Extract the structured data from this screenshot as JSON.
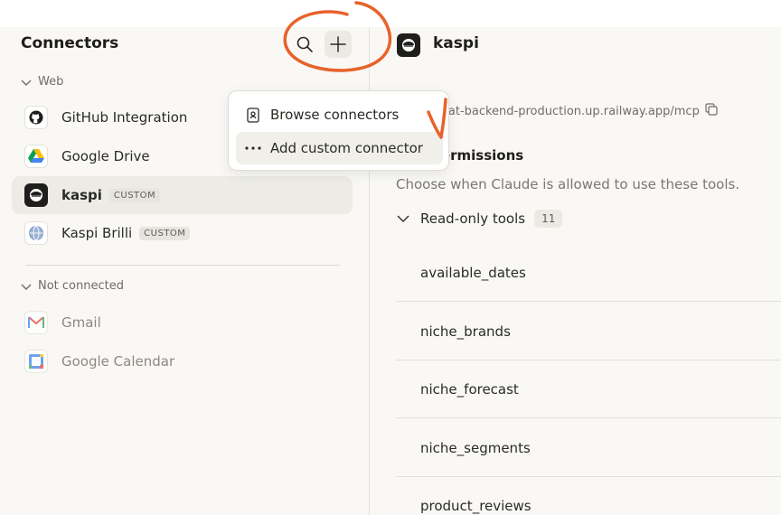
{
  "sidebar": {
    "title": "Connectors",
    "sections": {
      "web": "Web",
      "not_connected": "Not connected"
    },
    "items": [
      {
        "label": "GitHub Integration",
        "icon": "github-icon"
      },
      {
        "label": "Google Drive",
        "icon": "google-drive-icon"
      },
      {
        "label": "kaspi",
        "badge": "CUSTOM",
        "icon": "kaspi-logo-icon"
      },
      {
        "label": "Kaspi Brilli",
        "badge": "CUSTOM",
        "icon": "globe-icon"
      },
      {
        "label": "Gmail",
        "icon": "gmail-icon"
      },
      {
        "label": "Google Calendar",
        "icon": "google-calendar-icon"
      }
    ]
  },
  "menu": {
    "items": [
      {
        "label": "Browse connectors",
        "icon": "book-icon"
      },
      {
        "label": "Add custom connector",
        "icon": "ellipsis-icon"
      }
    ]
  },
  "detail": {
    "title": "kaspi",
    "url": "stat-backend-production.up.railway.app/mcp",
    "tool_permissions_title": "Tool permissions",
    "tool_permissions_desc": "Choose when Claude is allowed to use these tools.",
    "readonly_label": "Read-only tools",
    "readonly_count": "11",
    "tools": [
      "available_dates",
      "niche_brands",
      "niche_forecast",
      "niche_segments",
      "product_reviews"
    ]
  },
  "colors": {
    "annotation": "#e8622a",
    "background": "#f9f8f5"
  }
}
